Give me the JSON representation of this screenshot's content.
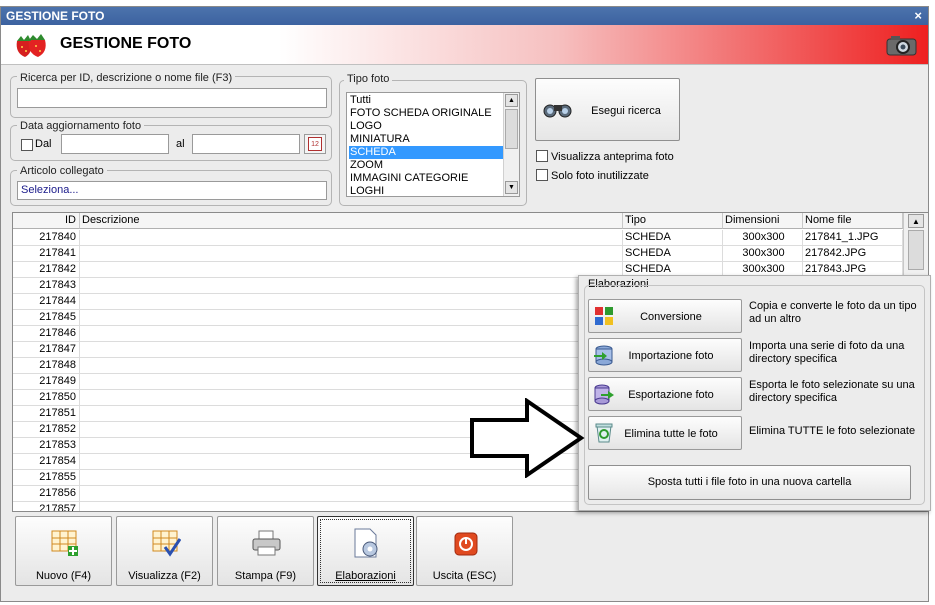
{
  "window": {
    "title": "GESTIONE FOTO",
    "close_glyph": "×"
  },
  "header": {
    "title": "GESTIONE FOTO",
    "logo_icon": "strawberry-icon",
    "camera_icon": "camera-icon"
  },
  "search": {
    "legend": "Ricerca per ID, descrizione o nome file (F3)",
    "value": ""
  },
  "date_filter": {
    "legend": "Data aggiornamento foto",
    "from_label": "Dal",
    "to_label": "al",
    "from_value": "",
    "to_value": "",
    "calendar_icon": "calendar-icon",
    "calendar_text": "12"
  },
  "article": {
    "legend": "Articolo collegato",
    "value": "Seleziona..."
  },
  "photo_type": {
    "legend": "Tipo foto",
    "items": [
      "Tutti",
      "FOTO SCHEDA ORIGINALE",
      "LOGO",
      "MINIATURA",
      "SCHEDA",
      "ZOOM",
      "IMMAGINI CATEGORIE",
      "LOGHI"
    ],
    "selected": "SCHEDA"
  },
  "search_button": {
    "label": "Esegui ricerca",
    "icon": "binoculars-icon"
  },
  "options": {
    "preview": "Visualizza anteprima foto",
    "unused": "Solo foto inutilizzate"
  },
  "grid": {
    "columns": [
      "ID",
      "Descrizione",
      "Tipo",
      "Dimensioni",
      "Nome file"
    ],
    "rows": [
      {
        "id": "217840",
        "desc": "",
        "tipo": "SCHEDA",
        "dim": "300x300",
        "file": "217841_1.JPG"
      },
      {
        "id": "217841",
        "desc": "",
        "tipo": "SCHEDA",
        "dim": "300x300",
        "file": "217842.JPG"
      },
      {
        "id": "217842",
        "desc": "",
        "tipo": "SCHEDA",
        "dim": "300x300",
        "file": "217843.JPG"
      },
      {
        "id": "217843",
        "desc": "",
        "tipo": "",
        "dim": "",
        "file": ""
      },
      {
        "id": "217844",
        "desc": "",
        "tipo": "",
        "dim": "",
        "file": ""
      },
      {
        "id": "217845",
        "desc": "",
        "tipo": "",
        "dim": "",
        "file": ""
      },
      {
        "id": "217846",
        "desc": "",
        "tipo": "",
        "dim": "",
        "file": ""
      },
      {
        "id": "217847",
        "desc": "",
        "tipo": "",
        "dim": "",
        "file": ""
      },
      {
        "id": "217848",
        "desc": "",
        "tipo": "",
        "dim": "",
        "file": ""
      },
      {
        "id": "217849",
        "desc": "",
        "tipo": "",
        "dim": "",
        "file": ""
      },
      {
        "id": "217850",
        "desc": "",
        "tipo": "",
        "dim": "",
        "file": ""
      },
      {
        "id": "217851",
        "desc": "",
        "tipo": "",
        "dim": "",
        "file": ""
      },
      {
        "id": "217852",
        "desc": "",
        "tipo": "",
        "dim": "",
        "file": ""
      },
      {
        "id": "217853",
        "desc": "",
        "tipo": "",
        "dim": "",
        "file": ""
      },
      {
        "id": "217854",
        "desc": "",
        "tipo": "",
        "dim": "",
        "file": ""
      },
      {
        "id": "217855",
        "desc": "",
        "tipo": "",
        "dim": "",
        "file": ""
      },
      {
        "id": "217856",
        "desc": "",
        "tipo": "",
        "dim": "",
        "file": ""
      },
      {
        "id": "217857",
        "desc": "",
        "tipo": "",
        "dim": "",
        "file": ""
      }
    ]
  },
  "elaborazioni": {
    "legend": "Elaborazioni",
    "actions": [
      {
        "label": "Conversione",
        "desc": "Copia e converte le foto da un tipo ad un altro",
        "icon": "convert-icon"
      },
      {
        "label": "Importazione foto",
        "desc": "Importa una serie di foto da una directory specifica",
        "icon": "import-icon"
      },
      {
        "label": "Esportazione foto",
        "desc": "Esporta le foto selezionate su una directory specifica",
        "icon": "export-icon"
      },
      {
        "label": "Elimina tutte le foto",
        "desc": "Elimina TUTTE le foto selezionate",
        "icon": "recycle-bin-icon"
      }
    ],
    "move_all": "Sposta tutti i file foto in una nuova cartella"
  },
  "toolbar": [
    {
      "label": "Nuovo (F4)",
      "icon": "new-grid-icon"
    },
    {
      "label": "Visualizza (F2)",
      "icon": "view-grid-icon"
    },
    {
      "label": "Stampa (F9)",
      "icon": "printer-icon"
    },
    {
      "label": "Elaborazioni",
      "icon": "gear-document-icon"
    },
    {
      "label": "Uscita (ESC)",
      "icon": "exit-icon"
    }
  ],
  "colors": {
    "titlebar": "#3c62a0",
    "selection": "#3399ff",
    "header_red": "#ee2020"
  }
}
